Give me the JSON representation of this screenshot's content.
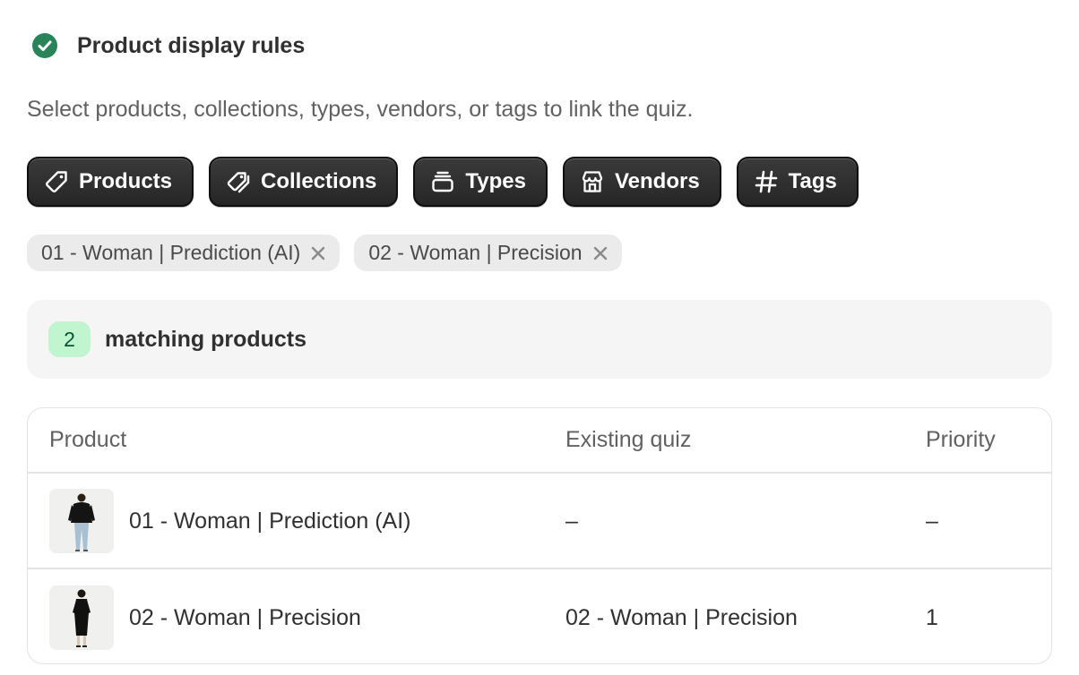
{
  "header": {
    "title": "Product display rules",
    "status_icon": "check-circle-icon",
    "status_color": "#29845a"
  },
  "description": "Select products, collections, types, vendors, or tags to link the quiz.",
  "filter_buttons": [
    {
      "label": "Products",
      "icon": "tag-icon"
    },
    {
      "label": "Collections",
      "icon": "tags-icon"
    },
    {
      "label": "Types",
      "icon": "stack-icon"
    },
    {
      "label": "Vendors",
      "icon": "store-icon"
    },
    {
      "label": "Tags",
      "icon": "hashtag-icon"
    }
  ],
  "selected_chips": [
    {
      "label": "01 - Woman | Prediction (AI)"
    },
    {
      "label": "02 - Woman | Precision"
    }
  ],
  "matching": {
    "count": "2",
    "label": "matching products",
    "badge_color": "#c1f5d0"
  },
  "table": {
    "headers": {
      "product": "Product",
      "existing_quiz": "Existing quiz",
      "priority": "Priority"
    },
    "rows": [
      {
        "product": "01 - Woman | Prediction (AI)",
        "existing_quiz": "–",
        "priority": "–",
        "thumbnail": "woman-in-jacket-and-jeans"
      },
      {
        "product": "02 - Woman | Precision",
        "existing_quiz": "02 - Woman | Precision",
        "priority": "1",
        "thumbnail": "woman-in-black-dress"
      }
    ]
  }
}
